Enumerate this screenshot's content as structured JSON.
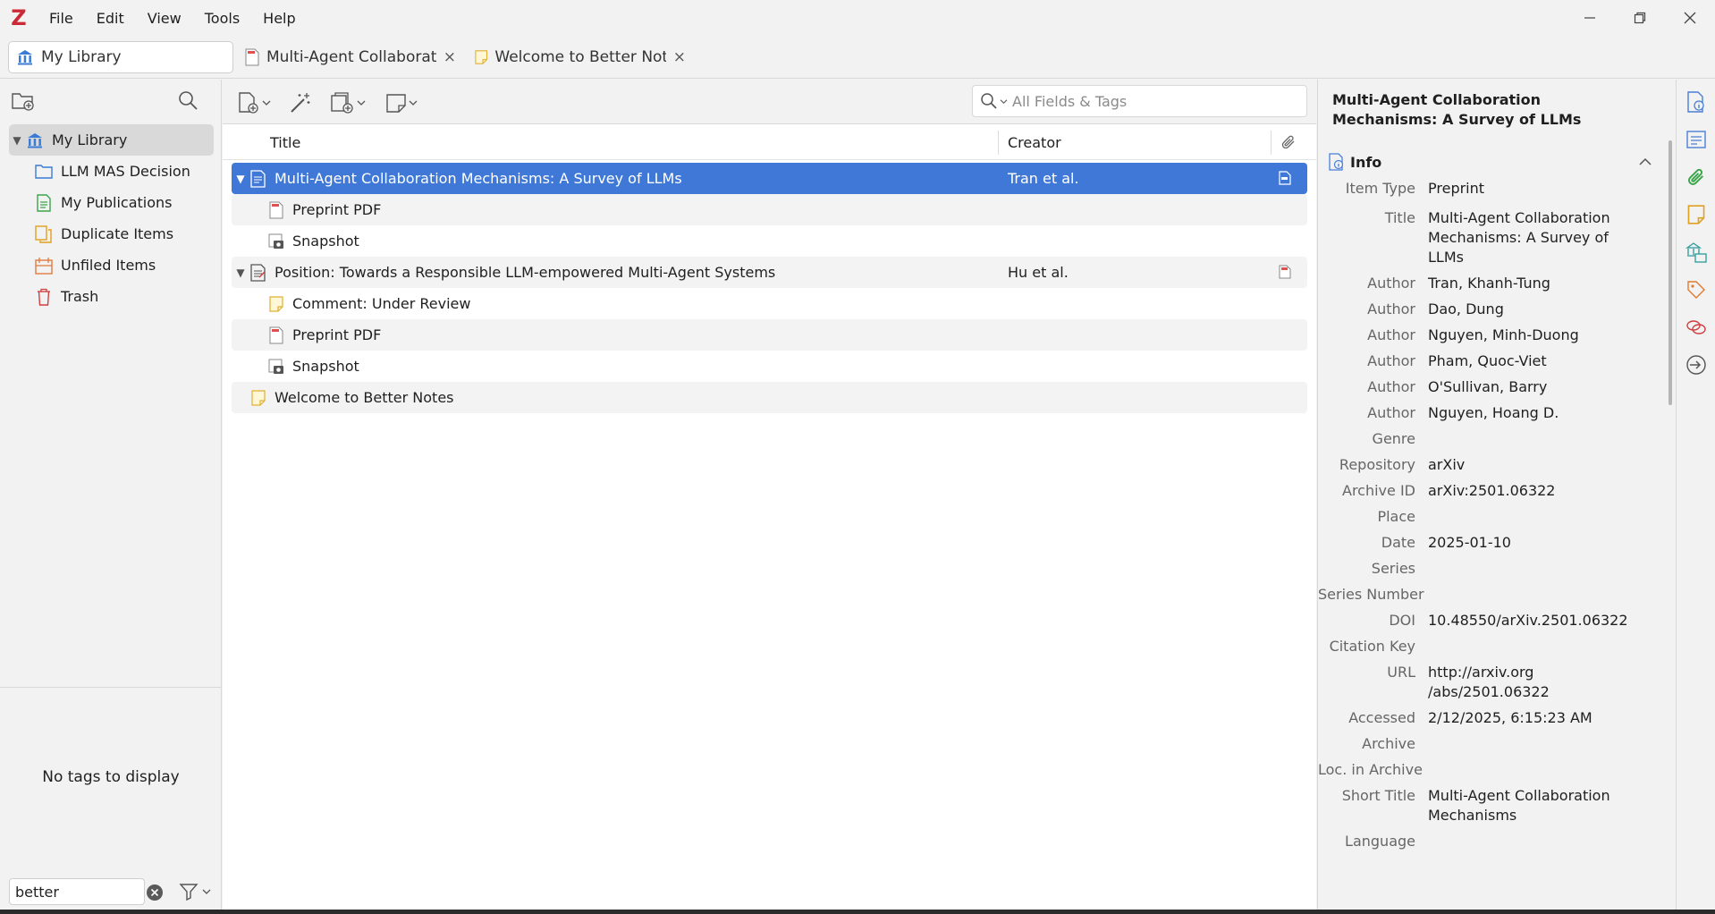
{
  "app": {
    "logo": "Z"
  },
  "menu": [
    "File",
    "Edit",
    "View",
    "Tools",
    "Help"
  ],
  "tabs": [
    {
      "label": "My Library"
    },
    {
      "label": "Multi-Agent Collaboration Mechanisms: A Survey of LLMs",
      "close": "×"
    },
    {
      "label": "Welcome to Better Notes",
      "close": "×"
    }
  ],
  "collections": [
    {
      "label": "My Library",
      "twisty": "▼"
    },
    {
      "label": "LLM MAS Decision"
    },
    {
      "label": "My Publications"
    },
    {
      "label": "Duplicate Items"
    },
    {
      "label": "Unfiled Items"
    },
    {
      "label": "Trash"
    }
  ],
  "tags": {
    "empty_text": "No tags to display",
    "filter_value": "better"
  },
  "search": {
    "placeholder": "All Fields & Tags"
  },
  "columns": {
    "title": "Title",
    "creator": "Creator"
  },
  "items": [
    {
      "title": "Multi-Agent Collaboration Mechanisms: A Survey of LLMs",
      "creator": "Tran et al.",
      "twisty": "▼"
    },
    {
      "title": "Preprint PDF"
    },
    {
      "title": "Snapshot"
    },
    {
      "title": "Position: Towards a Responsible LLM-empowered Multi-Agent Systems",
      "creator": "Hu et al.",
      "twisty": "▼"
    },
    {
      "title": "Comment: Under Review"
    },
    {
      "title": "Preprint PDF"
    },
    {
      "title": "Snapshot"
    },
    {
      "title": "Welcome to Better Notes"
    }
  ],
  "item_pane": {
    "header_title": "Multi-Agent Collaboration Mechanisms: A Survey of LLMs",
    "section_title": "Info",
    "fields": [
      {
        "label": "Item Type",
        "value": "Preprint"
      },
      {
        "label": "Title",
        "value": "Multi-Agent Collaboration Mechanisms: A Survey of LLMs"
      },
      {
        "label": "Author",
        "value": "Tran, Khanh-Tung"
      },
      {
        "label": "Author",
        "value": "Dao, Dung"
      },
      {
        "label": "Author",
        "value": "Nguyen, Minh-Duong"
      },
      {
        "label": "Author",
        "value": "Pham, Quoc-Viet"
      },
      {
        "label": "Author",
        "value": "O'Sullivan, Barry"
      },
      {
        "label": "Author",
        "value": "Nguyen, Hoang D."
      },
      {
        "label": "Genre",
        "value": ""
      },
      {
        "label": "Repository",
        "value": "arXiv"
      },
      {
        "label": "Archive ID",
        "value": "arXiv:2501.06322"
      },
      {
        "label": "Place",
        "value": ""
      },
      {
        "label": "Date",
        "value": "2025-01-10"
      },
      {
        "label": "Series",
        "value": ""
      },
      {
        "label": "Series Number",
        "value": ""
      },
      {
        "label": "DOI",
        "value": "10.48550/arXiv.2501.06322"
      },
      {
        "label": "Citation Key",
        "value": ""
      },
      {
        "label": "URL",
        "value": "http://arxiv.org /abs/2501.06322"
      },
      {
        "label": "Accessed",
        "value": "2/12/2025, 6:15:23 AM"
      },
      {
        "label": "Archive",
        "value": ""
      },
      {
        "label": "Loc. in Archive",
        "value": ""
      },
      {
        "label": "Short Title",
        "value": "Multi-Agent Collaboration Mechanisms"
      },
      {
        "label": "Language",
        "value": ""
      }
    ]
  },
  "colors": {
    "selection": "#3f78d6",
    "collection_folder": "#3a7bd5",
    "logo_red": "#cc2936"
  }
}
